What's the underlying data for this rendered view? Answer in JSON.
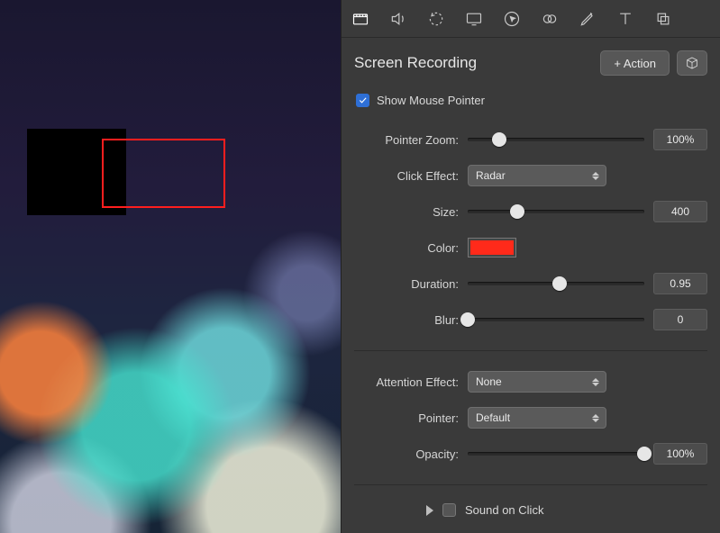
{
  "header": {
    "title": "Screen Recording",
    "action_button": "+ Action"
  },
  "show_pointer": {
    "label": "Show Mouse Pointer",
    "checked": true
  },
  "rows": {
    "pointer_zoom": {
      "label": "Pointer Zoom:",
      "value": "100%",
      "pos": 18
    },
    "click_effect": {
      "label": "Click Effect:",
      "value": "Radar"
    },
    "size": {
      "label": "Size:",
      "value": "400",
      "pos": 28
    },
    "color": {
      "label": "Color:",
      "hex": "#ff2a1a"
    },
    "duration": {
      "label": "Duration:",
      "value": "0.95",
      "pos": 52
    },
    "blur": {
      "label": "Blur:",
      "value": "0",
      "pos": 0
    },
    "attention": {
      "label": "Attention Effect:",
      "value": "None"
    },
    "pointer": {
      "label": "Pointer:",
      "value": "Default"
    },
    "opacity": {
      "label": "Opacity:",
      "value": "100%",
      "pos": 100
    }
  },
  "sound": {
    "label": "Sound on Click",
    "checked": false
  }
}
